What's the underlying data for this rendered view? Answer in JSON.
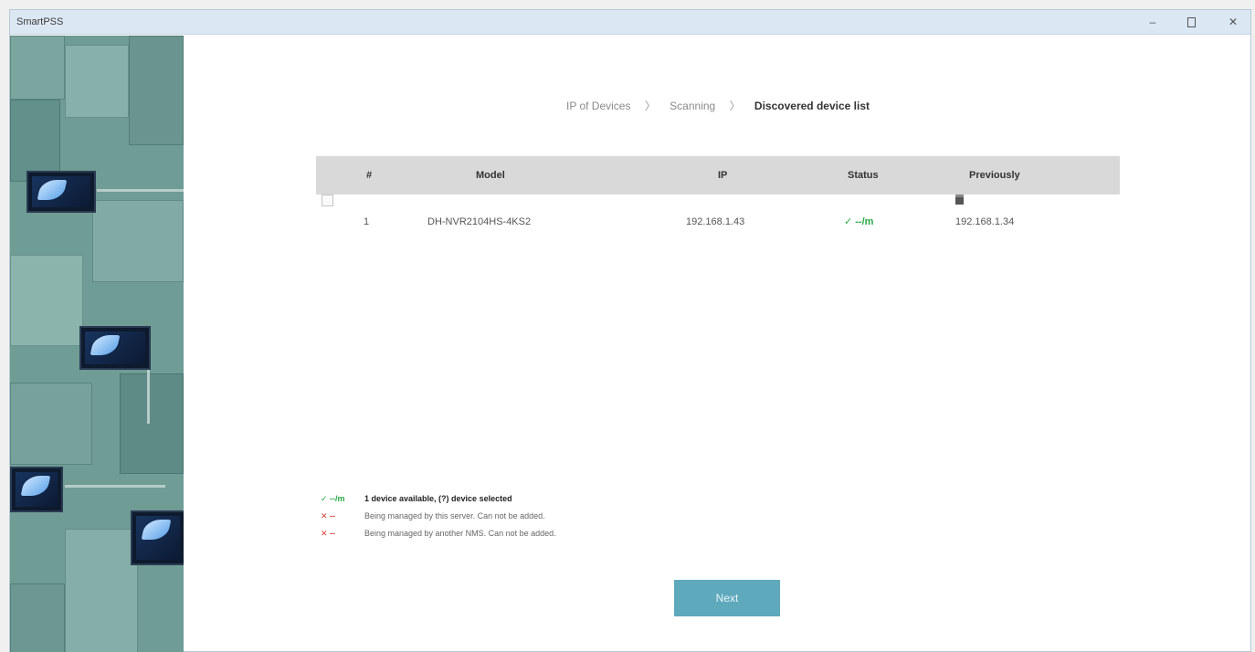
{
  "window": {
    "title": "SmartPSS",
    "controls": {
      "minimize": "–",
      "close": "✕"
    }
  },
  "breadcrumb": {
    "steps": [
      "IP of Devices",
      "Scanning",
      "Discovered device list"
    ],
    "separator": "〉"
  },
  "table": {
    "headers": {
      "index": "#",
      "model": "Model",
      "ip": "IP",
      "status": "Status",
      "previously": "Previously"
    },
    "rows": [
      {
        "index": "1",
        "model": "DH-NVR2104HS-4KS2",
        "ip": "192.168.1.43",
        "status": "✓ --/m",
        "previously": "192.168.1.34",
        "previously_icon": "server-icon"
      }
    ]
  },
  "legend": [
    {
      "symbol": "✓ --/m",
      "color": "#27a844",
      "text": "1 device available, (?) device selected"
    },
    {
      "symbol": "✕ --",
      "color": "#d23b3b",
      "text": "Being managed by this server. Can not be added."
    },
    {
      "symbol": "✕ --",
      "color": "#d23b3b",
      "text": "Being managed by another NMS. Can not be added."
    }
  ],
  "actions": {
    "next_label": "Next"
  },
  "colors": {
    "titlebar": "#dbe7f3",
    "table_header": "#d9d9d9",
    "status_ok": "#27a844",
    "status_error": "#d23b3b",
    "primary_button": "#5fa9bd",
    "sidebar": "#6f9c95"
  }
}
